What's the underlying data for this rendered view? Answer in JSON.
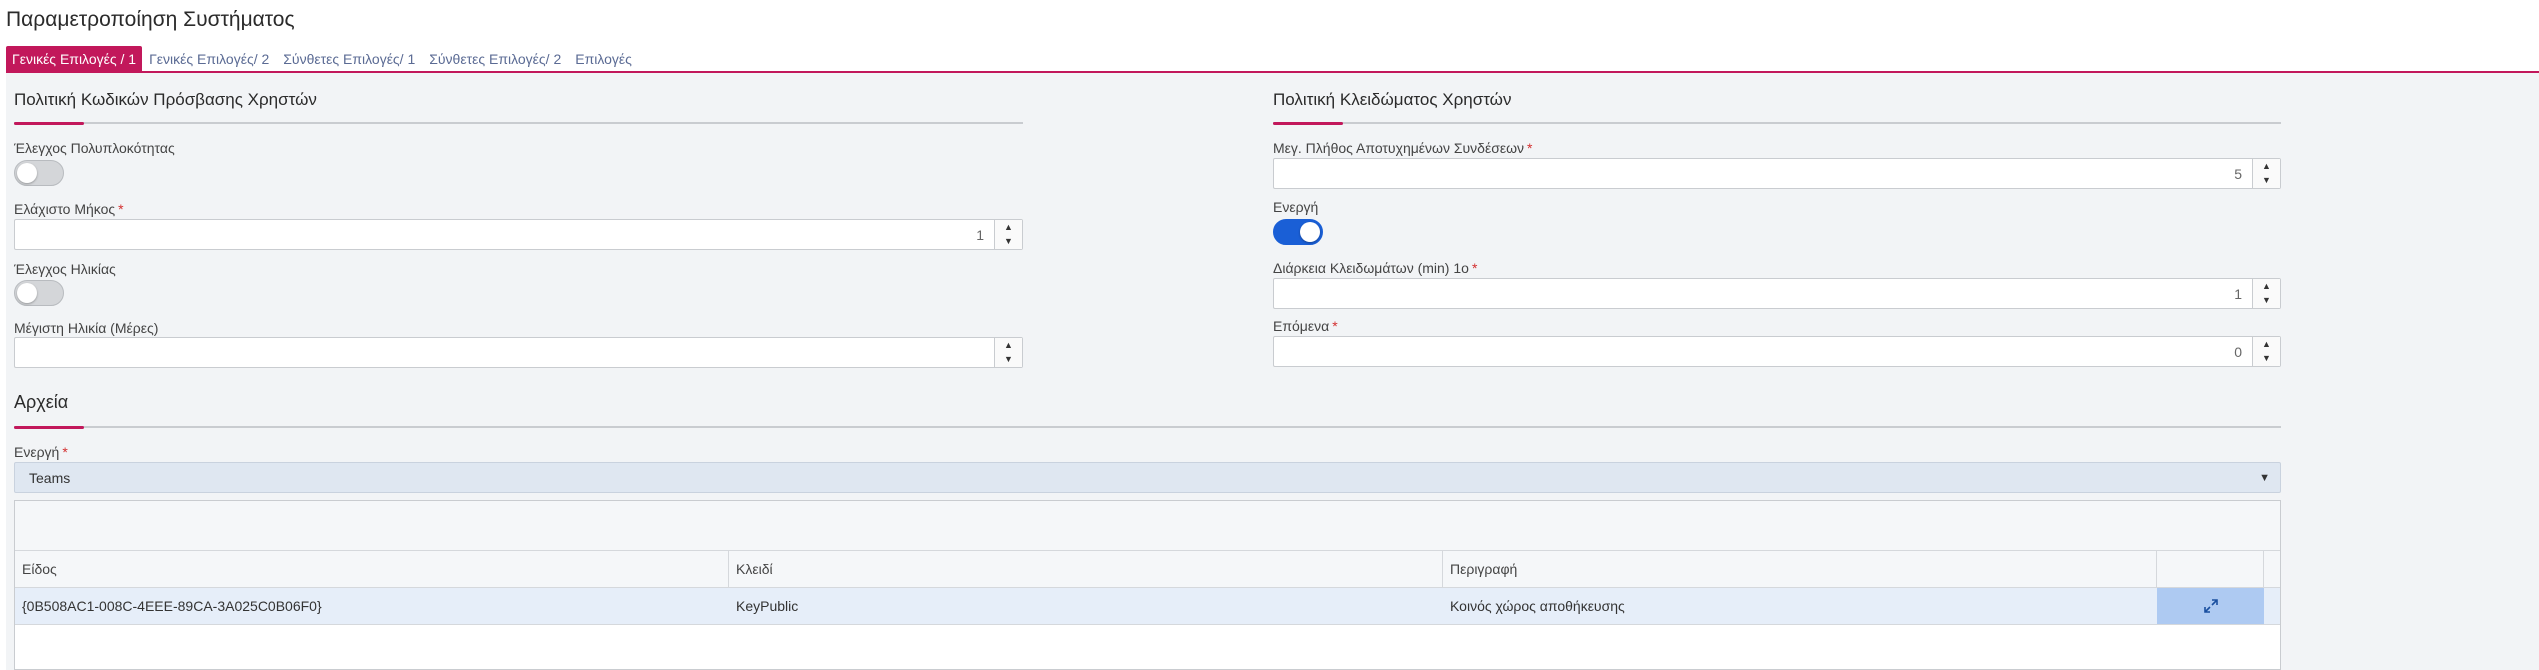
{
  "page": {
    "title": "Παραμετροποίηση Συστήματος"
  },
  "tabs": [
    {
      "label": "Γενικές Επιλογές / 1",
      "active": true
    },
    {
      "label": "Γενικές Επιλογές/ 2",
      "active": false
    },
    {
      "label": "Σύνθετες Επιλογές/ 1",
      "active": false
    },
    {
      "label": "Σύνθετες Επιλογές/ 2",
      "active": false
    },
    {
      "label": "Επιλογές",
      "active": false
    }
  ],
  "password_policy": {
    "title": "Πολιτική Κωδικών Πρόσβασης Χρηστών",
    "complexity_label": "Έλεγχος Πολυπλοκότητας",
    "complexity_on": false,
    "min_length_label": "Ελάχιστο Μήκος",
    "min_length_value": "1",
    "age_check_label": "Έλεγχος Ηλικίας",
    "age_check_on": false,
    "max_age_label": "Μέγιστη Ηλικία (Μέρες)",
    "max_age_value": ""
  },
  "lock_policy": {
    "title": "Πολιτική Κλειδώματος Χρηστών",
    "max_failed_label": "Μεγ. Πλήθος Αποτυχημένων Συνδέσεων",
    "max_failed_value": "5",
    "active_label": "Ενεργή",
    "active_on": true,
    "duration_label": "Διάρκεια Κλειδωμάτων (min) 1ο",
    "duration_value": "1",
    "next_label": "Επόμενα",
    "next_value": "0"
  },
  "files": {
    "title": "Αρχεία",
    "active_label": "Ενεργή",
    "active_value": "Teams",
    "columns": [
      "Είδος",
      "Κλειδί",
      "Περιγραφή"
    ],
    "rows": [
      {
        "type": "{0B508AC1-008C-4EEE-89CA-3A025C0B06F0}",
        "key": "KeyPublic",
        "description": "Κοινός χώρος αποθήκευσης"
      }
    ]
  },
  "common": {
    "required_mark": "*"
  },
  "colors": {
    "accent": "#c2185b",
    "toggle_on": "#1a5fd6",
    "row_selected": "#e6eef9",
    "expand_cell": "#aecaf2"
  },
  "icons": {
    "spin_up": "▲",
    "spin_down": "▼",
    "dropdown": "▼",
    "expand": "expand-icon"
  }
}
